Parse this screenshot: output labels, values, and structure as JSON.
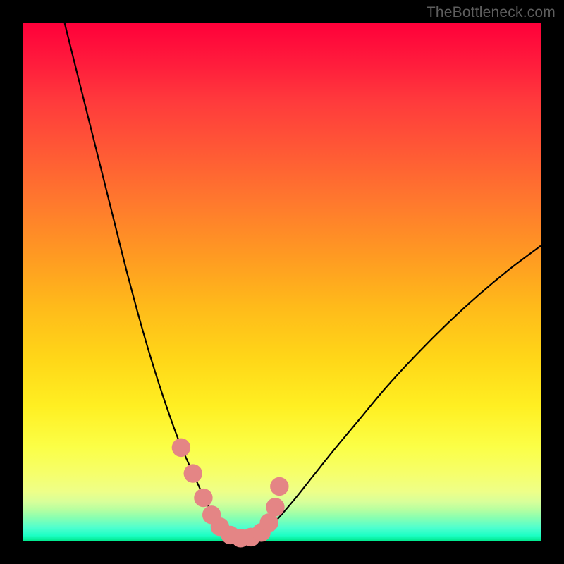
{
  "watermark": "TheBottleneck.com",
  "colors": {
    "frame": "#000000",
    "curve": "#000000",
    "marker_fill": "#e48585",
    "marker_stroke": "#cf6f6f"
  },
  "chart_data": {
    "type": "line",
    "title": "",
    "xlabel": "",
    "ylabel": "",
    "xlim": [
      0,
      100
    ],
    "ylim": [
      0,
      100
    ],
    "series": [
      {
        "name": "curve",
        "x": [
          8.0,
          10,
          12,
          14,
          16,
          18,
          20,
          22,
          24,
          26,
          28,
          30,
          32,
          34,
          35.5,
          37,
          39,
          41,
          43,
          45,
          48,
          52,
          56,
          60,
          65,
          70,
          76,
          82,
          88,
          94,
          100
        ],
        "values": [
          100,
          92,
          84,
          76,
          68,
          60,
          52,
          44.5,
          37.5,
          31,
          25,
          19.5,
          14.8,
          10.4,
          7.2,
          4.4,
          2.0,
          0.8,
          0.4,
          0.9,
          3.0,
          7.5,
          12.5,
          17.5,
          23.5,
          29.5,
          36,
          42,
          47.5,
          52.5,
          57
        ]
      }
    ],
    "markers": [
      {
        "x": 30.5,
        "y": 18.0
      },
      {
        "x": 32.8,
        "y": 13.0
      },
      {
        "x": 34.8,
        "y": 8.3
      },
      {
        "x": 36.4,
        "y": 5.0
      },
      {
        "x": 38.0,
        "y": 2.7
      },
      {
        "x": 40.0,
        "y": 1.1
      },
      {
        "x": 42.0,
        "y": 0.5
      },
      {
        "x": 44.0,
        "y": 0.7
      },
      {
        "x": 46.0,
        "y": 1.6
      },
      {
        "x": 47.5,
        "y": 3.5
      },
      {
        "x": 48.7,
        "y": 6.5
      },
      {
        "x": 49.5,
        "y": 10.5
      }
    ],
    "marker_radius_domain": 1.8
  }
}
